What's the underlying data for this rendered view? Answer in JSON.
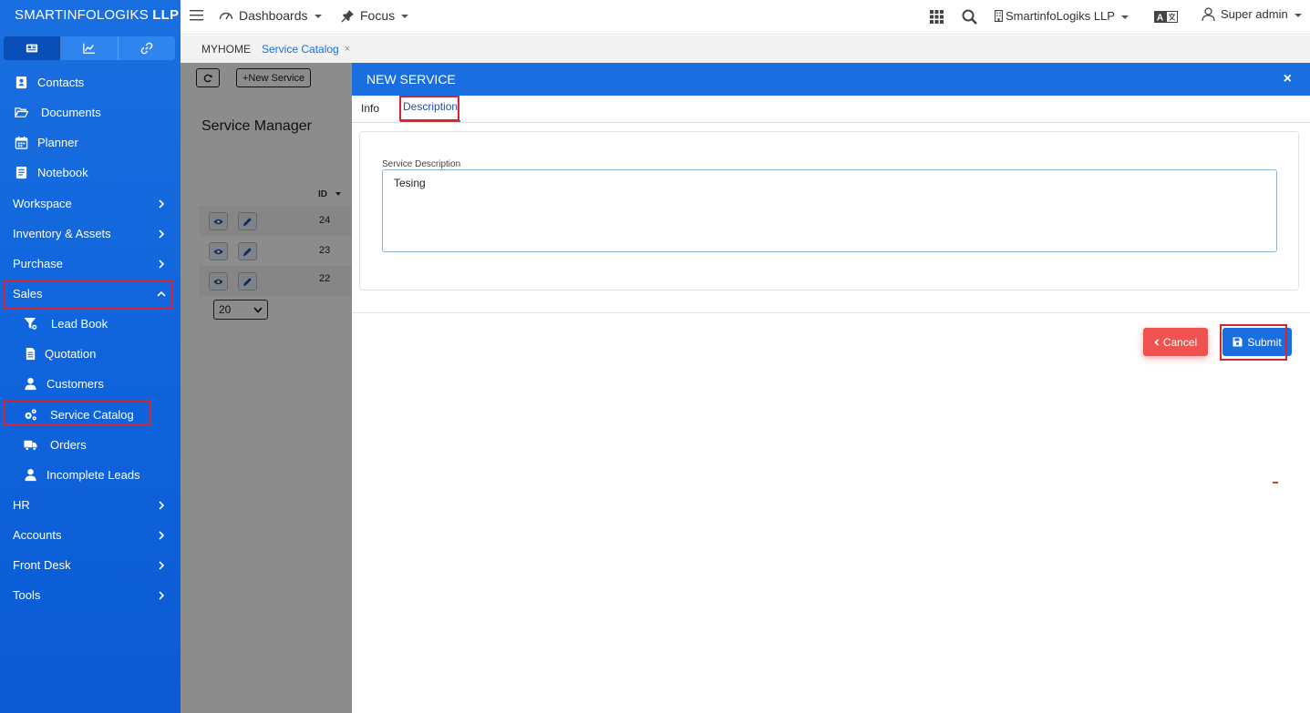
{
  "brand": {
    "name_light": "SMARTINFOLOGIKS",
    "name_bold": "LLP"
  },
  "colors": {
    "primary": "#1a6fe0",
    "danger": "#ef5350",
    "highlight": "#d9232e"
  },
  "sidebar": {
    "tabs": [
      {
        "icon": "dashboard-card-icon",
        "active": true
      },
      {
        "icon": "chart-icon",
        "active": false
      },
      {
        "icon": "link-icon",
        "active": false
      }
    ],
    "items": [
      {
        "label": "Contacts",
        "icon": "contact-book-icon"
      },
      {
        "label": "Documents",
        "icon": "folder-open-icon"
      },
      {
        "label": "Planner",
        "icon": "calendar-icon"
      },
      {
        "label": "Notebook",
        "icon": "notebook-icon"
      },
      {
        "label": "Workspace",
        "expandable": true
      },
      {
        "label": "Inventory & Assets",
        "expandable": true
      },
      {
        "label": "Purchase",
        "expandable": true
      },
      {
        "label": "Sales",
        "expandable": true,
        "expanded": true
      },
      {
        "label": "Lead Book",
        "icon": "filter-icon",
        "sub": true
      },
      {
        "label": "Quotation",
        "icon": "document-icon",
        "sub": true
      },
      {
        "label": "Customers",
        "icon": "user-icon",
        "sub": true
      },
      {
        "label": "Service Catalog",
        "icon": "cogs-icon",
        "sub": true,
        "active": true
      },
      {
        "label": "Orders",
        "icon": "truck-icon",
        "sub": true
      },
      {
        "label": "Incomplete Leads",
        "icon": "user-icon",
        "sub": true
      },
      {
        "label": "HR",
        "expandable": true
      },
      {
        "label": "Accounts",
        "expandable": true
      },
      {
        "label": "Front Desk",
        "expandable": true
      },
      {
        "label": "Tools",
        "expandable": true
      }
    ]
  },
  "topbar": {
    "dashboards_label": "Dashboards",
    "focus_label": "Focus",
    "company_label": "SmartinfoLogiks LLP",
    "user_label": "Super admin"
  },
  "breadcrumb": {
    "home": "MYHOME",
    "active": "Service Catalog",
    "close": "×"
  },
  "background_page": {
    "new_service_label": "+New Service",
    "title": "Service Manager",
    "id_header": "ID",
    "rows": [
      {
        "id": "24"
      },
      {
        "id": "23"
      },
      {
        "id": "22"
      }
    ],
    "page_size": "20"
  },
  "modal": {
    "title": "NEW SERVICE",
    "close": "×",
    "tabs": [
      {
        "label": "Info"
      },
      {
        "label": "Description",
        "active": true
      }
    ],
    "description_label": "Service Description",
    "description_value": "Tesing",
    "cancel_label": "Cancel",
    "submit_label": "Submit"
  }
}
